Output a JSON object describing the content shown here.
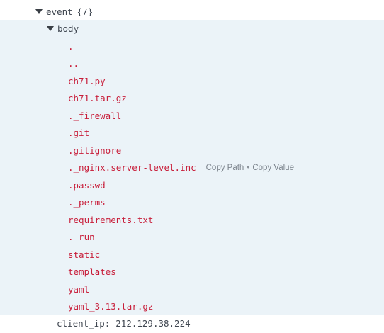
{
  "tree": {
    "root_key": "event",
    "root_count": "{7}",
    "child_key": "body",
    "items": [
      ".",
      "..",
      "ch71.py",
      "ch71.tar.gz",
      "._firewall",
      ".git",
      ".gitignore",
      "._nginx.server-level.inc",
      ".passwd",
      "._perms",
      "requirements.txt",
      "._run",
      "static",
      "templates",
      "yaml",
      "yaml_3.13.tar.gz"
    ],
    "hover_actions": {
      "copy_path": "Copy Path",
      "separator": "•",
      "copy_value": "Copy Value"
    },
    "client_ip_key": "client_ip:",
    "client_ip_value": "212.129.38.224"
  }
}
